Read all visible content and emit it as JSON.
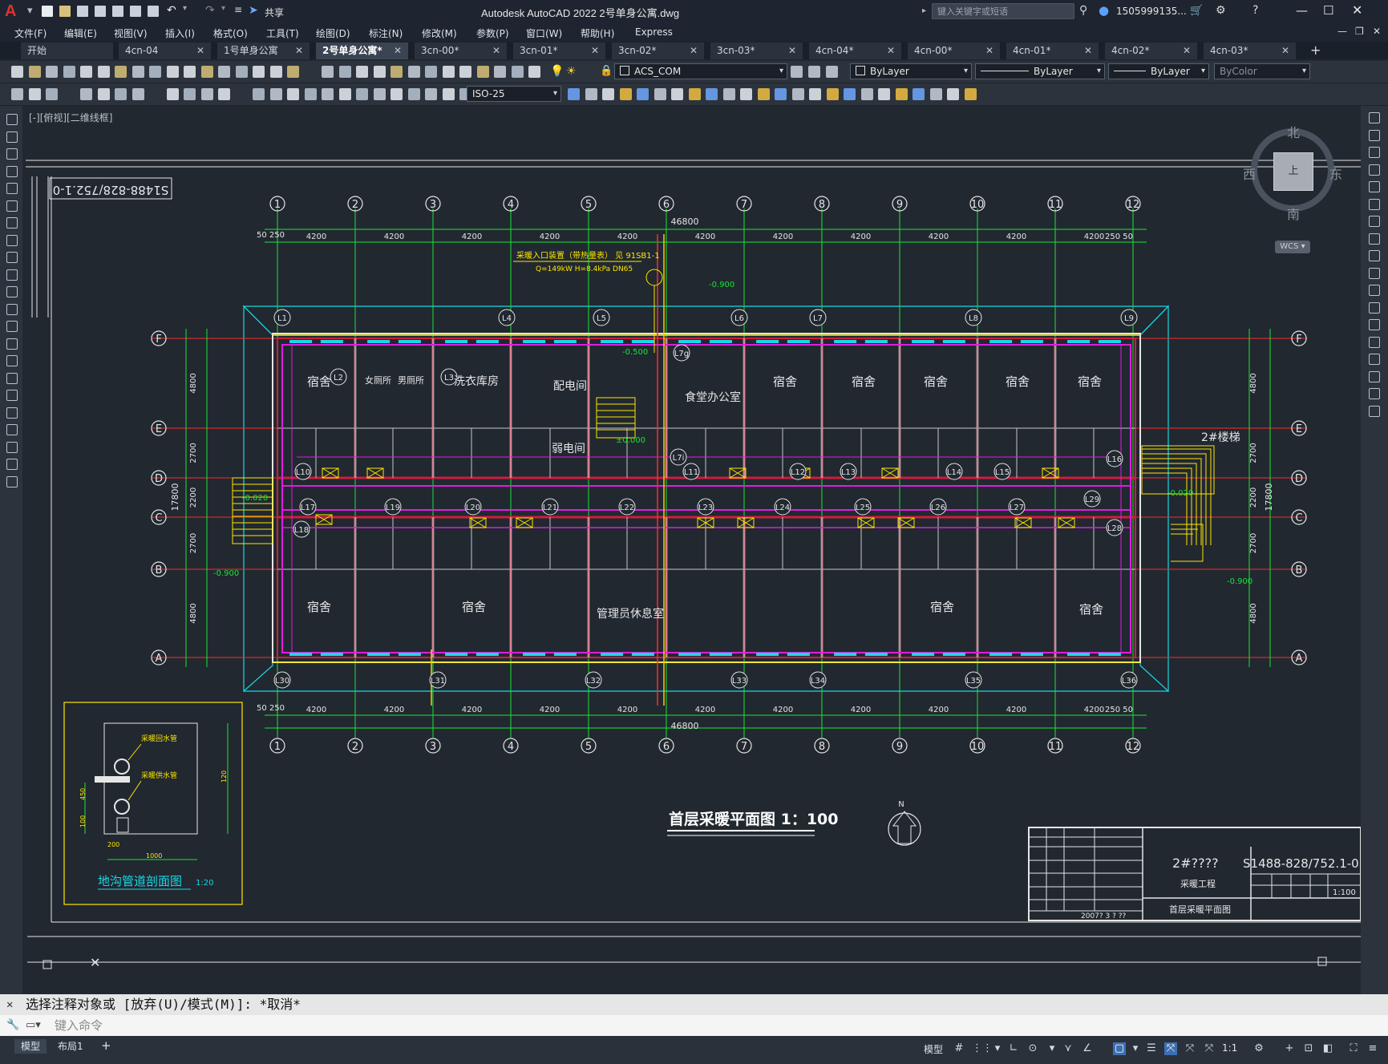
{
  "titlebar": {
    "app_title": "Autodesk AutoCAD 2022    2号单身公寓.dwg",
    "share_label": "共享",
    "search_placeholder": "键入关键字或短语",
    "user": "1505999135...",
    "window_controls": [
      "minimize-icon",
      "maximize-icon",
      "close-icon"
    ]
  },
  "menus": [
    "文件(F)",
    "编辑(E)",
    "视图(V)",
    "插入(I)",
    "格式(O)",
    "工具(T)",
    "绘图(D)",
    "标注(N)",
    "修改(M)",
    "参数(P)",
    "窗口(W)",
    "帮助(H)",
    "Express"
  ],
  "tabs": [
    {
      "label": "开始",
      "closable": false
    },
    {
      "label": "4cn-04",
      "closable": true
    },
    {
      "label": "1号单身公寓",
      "closable": true
    },
    {
      "label": "2号单身公寓*",
      "closable": true,
      "active": true
    },
    {
      "label": "3cn-00*",
      "closable": true
    },
    {
      "label": "3cn-01*",
      "closable": true
    },
    {
      "label": "3cn-02*",
      "closable": true
    },
    {
      "label": "3cn-03*",
      "closable": true
    },
    {
      "label": "4cn-04*",
      "closable": true
    },
    {
      "label": "4cn-00*",
      "closable": true
    },
    {
      "label": "4cn-01*",
      "closable": true
    },
    {
      "label": "4cn-02*",
      "closable": true
    },
    {
      "label": "4cn-03*",
      "closable": true
    }
  ],
  "toolbar": {
    "layer_value": "ACS_COM",
    "color_value": "ByLayer",
    "linetype_value": "ByLayer",
    "lineweight_value": "ByLayer",
    "plotstyle_value": "ByColor",
    "dimstyle_value": "ISO-25"
  },
  "viewport_label": "[-][俯视][二维线框]",
  "viewcube": {
    "north": "北",
    "south": "南",
    "east": "东",
    "west": "西",
    "top": "上",
    "wcs": "WCS"
  },
  "drawing": {
    "sheet_code_rotated": "S1488-828/752.1-0",
    "plan_title": "首层采暖平面图 1：100",
    "section_title": "地沟管道剖面图",
    "section_scale": "1:20",
    "total_dim": "46800",
    "bay_dim": "4200",
    "edge_dims": [
      "50 250",
      "250 50"
    ],
    "axis_numbers": [
      "1",
      "2",
      "3",
      "4",
      "5",
      "6",
      "7",
      "8",
      "9",
      "10",
      "11",
      "12"
    ],
    "axis_letters": [
      "F",
      "E",
      "D",
      "C",
      "B",
      "A"
    ],
    "left_dims": [
      "4800",
      "2700",
      "2200",
      "2700",
      "4800"
    ],
    "total_depth": "17800",
    "inlet_note": "采暖入口装置（带热量表） 见 91SB1-1",
    "inlet_note2": "Q=149kW H=8.4kPa DN65",
    "rooms": {
      "dorm": "宿舍",
      "women_wc": "女厕所",
      "men_wc": "男厕所",
      "storage": "洗衣库房",
      "elec": "配电间",
      "weak": "弱电间",
      "canteen_office": "食堂办公室",
      "admin": "管理员休息室",
      "stair2": "2#楼梯"
    },
    "levels": [
      "-0.900",
      "-0.500",
      "±0.000",
      "-0.020",
      "-0.900",
      "-0.900",
      "-0.020"
    ],
    "north_label": "N",
    "section_notes": [
      "采暖回水管",
      "采暖供水管"
    ],
    "section_dims": [
      "450",
      "120",
      "200",
      "1000",
      "100"
    ]
  },
  "title_block": {
    "project": "2#????",
    "sheet_code": "S1488-828/752.1-0",
    "discipline": "采暖工程",
    "sheet_name": "首层采暖平面图",
    "scale": "1:100",
    "date": "2007? 3 ? ??"
  },
  "command": {
    "history": "选择注释对象或 [放弃(U)/模式(M)]: *取消*",
    "placeholder": "键入命令"
  },
  "status": {
    "model_tab": "模型",
    "layout_tab": "布局1",
    "model_label": "模型",
    "scale": "1:1"
  }
}
